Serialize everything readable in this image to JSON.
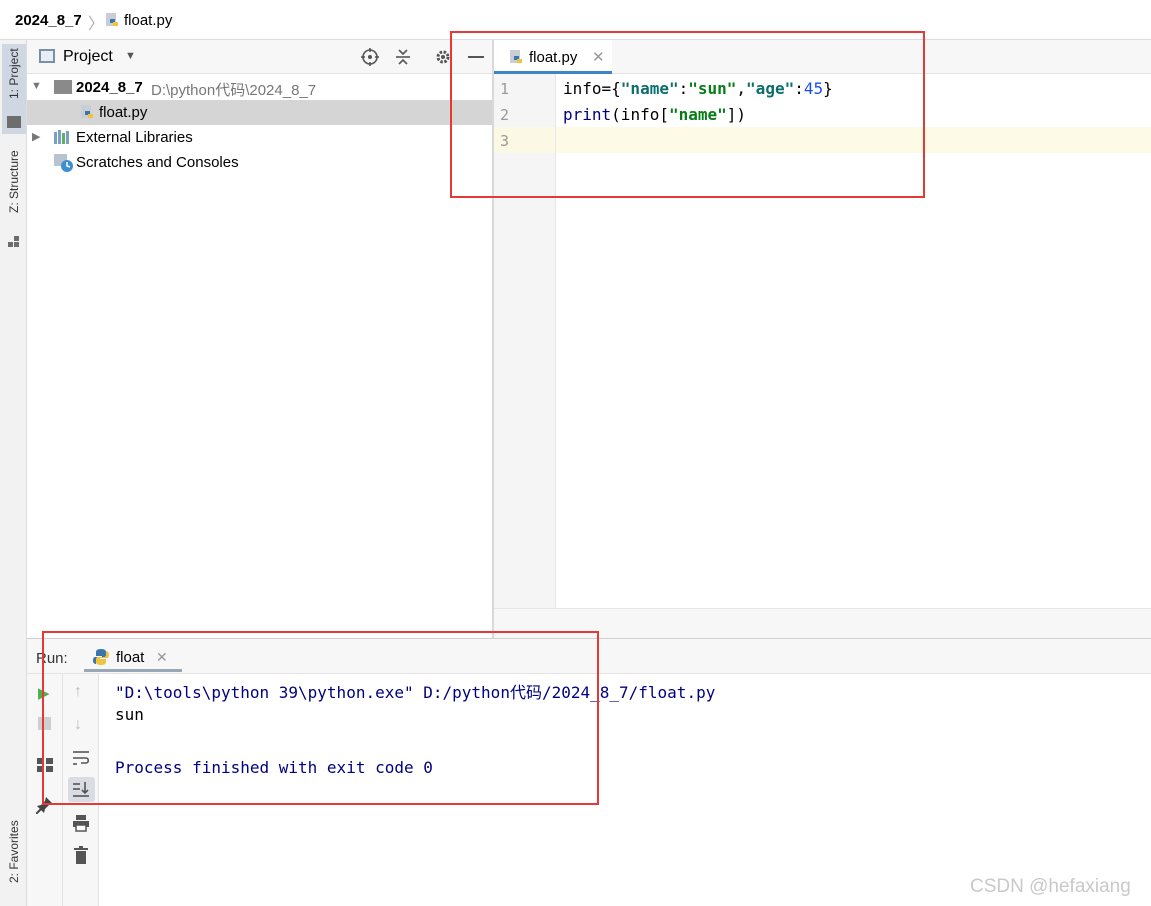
{
  "breadcrumb": {
    "project": "2024_8_7",
    "separator": "〉",
    "file": "float.py"
  },
  "left_stripe": {
    "project_tab": "1: Project",
    "structure_tab": "Z: Structure",
    "favorites_tab": "2: Favorites"
  },
  "project_panel": {
    "title": "Project",
    "tree": [
      {
        "label": "2024_8_7",
        "path": "D:\\python代码\\2024_8_7"
      },
      {
        "label": "float.py"
      },
      {
        "label": "External Libraries"
      },
      {
        "label": "Scratches and Consoles"
      }
    ]
  },
  "editor": {
    "tab_label": "float.py",
    "line_numbers": [
      "1",
      "2",
      "3"
    ],
    "lines": [
      {
        "t1": "info={",
        "s1": "\"name\"",
        "t2": ":",
        "s2": "\"sun\"",
        "t3": ",",
        "s3": "\"age\"",
        "t4": ":",
        "n1": "45",
        "t5": "}"
      },
      {
        "fn": "print",
        "t1": "(info[",
        "s1": "\"name\"",
        "t2": "])"
      }
    ]
  },
  "run_panel": {
    "label": "Run:",
    "tab_label": "float",
    "console": [
      "\"D:\\tools\\python 39\\python.exe\" D:/python代码/2024_8_7/float.py",
      "sun",
      "Process finished with exit code 0"
    ]
  },
  "watermark": "CSDN @hefaxiang",
  "colors": {
    "highlight_box": "#e53935",
    "tab_accent": "#4083c9",
    "string": "#067d17",
    "number": "#1750eb",
    "console_text": "#000080"
  }
}
